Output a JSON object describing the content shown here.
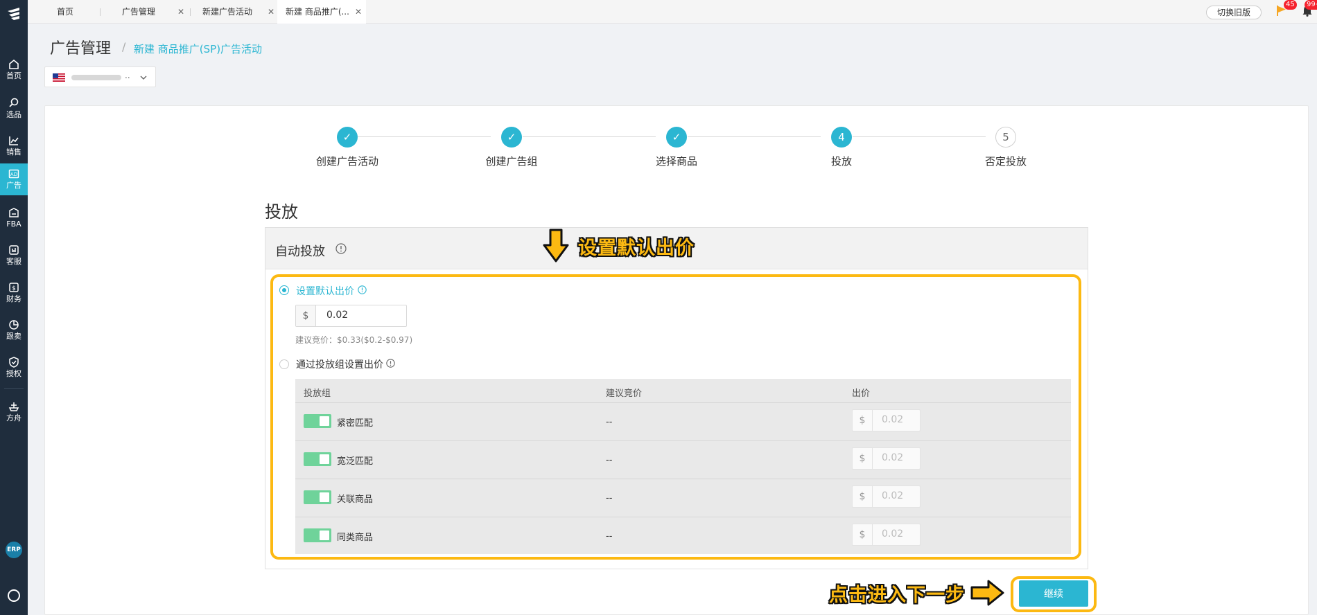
{
  "sidebar": {
    "items": [
      {
        "label": "首页",
        "icon": "home-icon"
      },
      {
        "label": "选品",
        "icon": "search-icon"
      },
      {
        "label": "销售",
        "icon": "chart-line-icon"
      },
      {
        "label": "广告",
        "icon": "ad-icon",
        "active": true
      },
      {
        "label": "FBA",
        "icon": "fba-icon"
      },
      {
        "label": "客服",
        "icon": "service-icon"
      },
      {
        "label": "财务",
        "icon": "finance-icon"
      },
      {
        "label": "跟卖",
        "icon": "pie-chart-icon"
      },
      {
        "label": "授权",
        "icon": "shield-icon"
      },
      {
        "label": "方舟",
        "icon": "ark-icon"
      }
    ],
    "erp_label": "ERP"
  },
  "tabs": [
    {
      "label": "首页",
      "closable": false
    },
    {
      "label": "广告管理",
      "closable": true
    },
    {
      "label": "新建广告活动",
      "closable": true
    },
    {
      "label": "新建 商品推广(...",
      "closable": true,
      "active": true
    }
  ],
  "topbar": {
    "switch_label": "切换旧版",
    "flag_badge": "45",
    "bell_badge": "99+"
  },
  "header": {
    "title": "广告管理",
    "breadcrumb_sep": "/",
    "breadcrumb_current": "新建 商品推广(SP)广告活动",
    "store_ellipsis": ".."
  },
  "steps": [
    {
      "label": "创建广告活动",
      "state": "done",
      "mark": "✓"
    },
    {
      "label": "创建广告组",
      "state": "done",
      "mark": "✓"
    },
    {
      "label": "选择商品",
      "state": "done",
      "mark": "✓"
    },
    {
      "label": "投放",
      "state": "current",
      "mark": "4"
    },
    {
      "label": "否定投放",
      "state": "todo",
      "mark": "5"
    }
  ],
  "section": {
    "title": "投放",
    "panel_title": "自动投放"
  },
  "options": {
    "default_bid_label": "设置默认出价",
    "currency": "$",
    "default_bid_value": "0.02",
    "suggest_text": "建议竞价：$0.33($0.2-$0.97)",
    "group_bid_label": "通过投放组设置出价"
  },
  "table": {
    "headers": [
      "投放组",
      "建议竞价",
      "出价"
    ],
    "rows": [
      {
        "name": "紧密匹配",
        "suggest": "--",
        "bid": "0.02"
      },
      {
        "name": "宽泛匹配",
        "suggest": "--",
        "bid": "0.02"
      },
      {
        "name": "关联商品",
        "suggest": "--",
        "bid": "0.02"
      },
      {
        "name": "同类商品",
        "suggest": "--",
        "bid": "0.02"
      }
    ]
  },
  "annotations": {
    "top": "设置默认出价",
    "bottom": "点击进入下一步"
  },
  "continue_label": "继续",
  "colors": {
    "accent": "#2bb6d2",
    "sidebar": "#1f2d3d",
    "highlight": "#fcb912",
    "toggle_on": "#6fd39a"
  }
}
